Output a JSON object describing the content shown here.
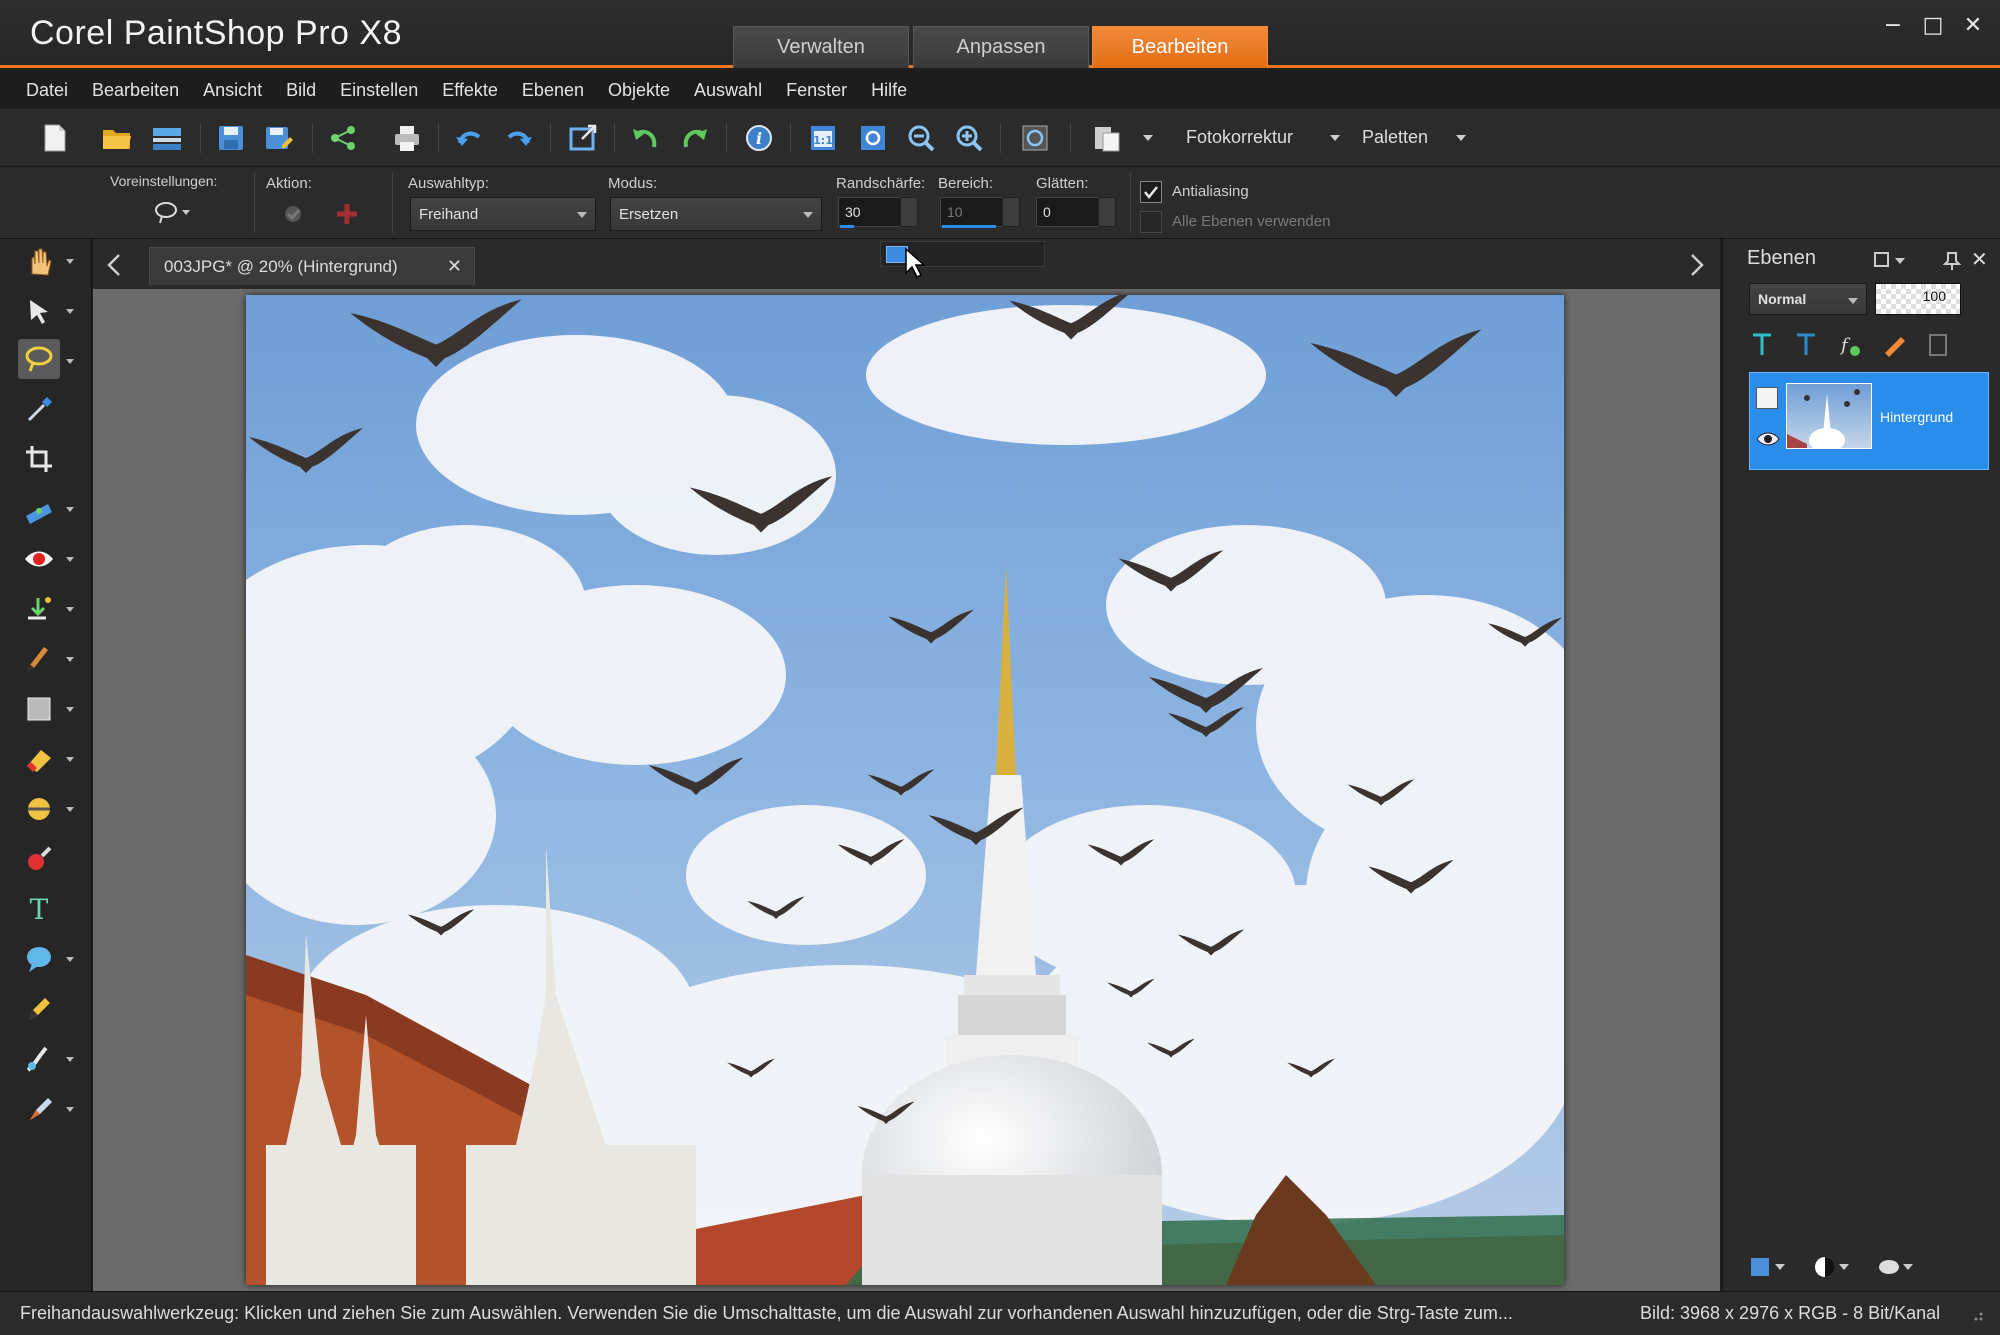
{
  "app": {
    "title": "Corel PaintShop Pro X8",
    "workspace_tabs": [
      {
        "label": "Verwalten",
        "active": false
      },
      {
        "label": "Anpassen",
        "active": false
      },
      {
        "label": "Bearbeiten",
        "active": true
      }
    ],
    "window_controls": {
      "minimize": "−",
      "maximize": "□",
      "close": "✕"
    }
  },
  "menu": [
    "Datei",
    "Bearbeiten",
    "Ansicht",
    "Bild",
    "Einstellen",
    "Effekte",
    "Ebenen",
    "Objekte",
    "Auswahl",
    "Fenster",
    "Hilfe"
  ],
  "toolbar": {
    "icons": [
      "new-file-icon",
      "open-folder-icon",
      "scan-icon",
      "save-icon",
      "save-as-icon",
      "share-icon",
      "print-icon",
      "undo-icon",
      "redo-icon",
      "resize-icon",
      "rotate-left-icon",
      "rotate-right-icon",
      "info-icon",
      "zoom-actual-icon",
      "fit-window-icon",
      "zoom-out-icon",
      "zoom-in-icon",
      "zoom-preset-icon",
      "paste-icon"
    ],
    "fotokorrektur_label": "Fotokorrektur",
    "paletten_label": "Paletten"
  },
  "tool_options": {
    "presets_label": "Voreinstellungen:",
    "action_label": "Aktion:",
    "selection_type_label": "Auswahltyp:",
    "selection_type_value": "Freihand",
    "mode_label": "Modus:",
    "mode_value": "Ersetzen",
    "feather_label": "Randschärfe:",
    "feather_value": "30",
    "range_label": "Bereich:",
    "range_value": "10",
    "smoothing_label": "Glätten:",
    "smoothing_value": "0",
    "antialiasing_label": "Antialiasing",
    "antialiasing_checked": true,
    "all_layers_label": "Alle Ebenen verwenden",
    "all_layers_checked": false
  },
  "document": {
    "tab_label": "003JPG* @  20% (Hintergrund)",
    "close_glyph": "✕"
  },
  "layers_panel": {
    "title": "Ebenen",
    "blend_mode": "Normal",
    "opacity": "100",
    "layer_name": "Hintergrund"
  },
  "status": {
    "hint": "Freihandauswahlwerkzeug: Klicken und ziehen Sie zum Auswählen. Verwenden Sie die Umschalttaste, um die Auswahl zur vorhandenen Auswahl hinzuzufügen, oder die Strg-Taste zum...",
    "image_info": "Bild:  3968 x 2976 x RGB - 8 Bit/Kanal"
  },
  "colors": {
    "accent": "#e8741e",
    "selected_layer": "#2a8dea"
  }
}
